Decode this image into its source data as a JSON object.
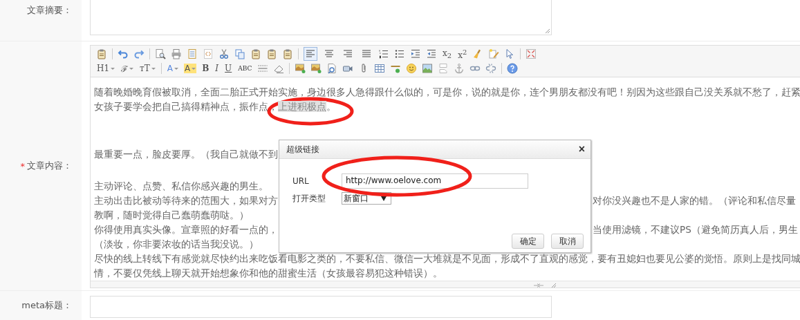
{
  "summary": {
    "label": "文章摘要："
  },
  "content_field": {
    "mark": "*",
    "label": "文章内容："
  },
  "editor": {
    "toolbar": {
      "alignment": [
        {
          "selected": true
        },
        {
          "selected": false
        },
        {
          "selected": false
        },
        {
          "selected": false
        }
      ],
      "text_buttons": [
        "x$_{2}$",
        "x$^{2}$",
        "H1",
        "ℱ",
        "ᴛT",
        "A",
        "A",
        "B",
        "I",
        "U",
        "ABC"
      ]
    },
    "lines": [
      {
        "segments": [
          {
            "text": "随着晚婚晚育假被取消，全面二胎正式开始实施，身边很多人急得跟什么似的，可是你，说的就是你，连个男朋友都没有吧！别因为这些跟自己没关系就不愁了，赶紧",
            "highlighted": false
          }
        ]
      },
      {
        "segments": [
          {
            "text": "女孩子要学会把自己搞得精神点，振作点，",
            "highlighted": false
          },
          {
            "text": "上进积极点",
            "highlighted": true
          },
          {
            "text": "。",
            "highlighted": false
          }
        ]
      },
      {
        "segments": [
          {
            "text": "最重要一点，脸皮要厚。（我自己就做不到",
            "highlighted": false
          }
        ]
      },
      {
        "segments": [
          {
            "text": "主动评论、点赞、私信你感兴趣的男生。",
            "highlighted": false
          }
        ]
      },
      {
        "segments": [
          {
            "text": "主动出击比被动等待来的范围大，如果对方",
            "highlighted": false
          }
        ],
        "after_dialog": "对你没兴趣也不是人家的错。（评论和私信尽量"
      },
      {
        "segments": [
          {
            "text": "教啊，随时觉得自己蠢萌蠢萌哒。）",
            "highlighted": false
          }
        ]
      },
      {
        "segments": [
          {
            "text": "你得使用真实头像。宣章照的好看一点的，",
            "highlighted": false
          }
        ],
        "after_dialog": "当使用滤镜，不建议PS（避免简历真人后，男生"
      },
      {
        "segments": [
          {
            "text": "（淡妆，你非要浓妆的话当我没说。）",
            "highlighted": false
          }
        ]
      },
      {
        "segments": [
          {
            "text": "尽快的线上转线下有感觉就尽快约出来吃饭看电影之类的，不要私信、微信一大堆就是不见面，形成不了直观的感觉，要有丑媳妇也要见公婆的觉悟。原则上是找同城",
            "highlighted": false
          }
        ]
      },
      {
        "segments": [
          {
            "text": "情，不要仅凭线上聊天就开始想象你和他的甜蜜生活（女孩最容易犯这种错误）。",
            "highlighted": false
          }
        ]
      }
    ]
  },
  "meta": {
    "label": "meta标题："
  },
  "dialog": {
    "title": "超级链接",
    "close": "×",
    "url_label": "URL",
    "url_value": "http://www.oelove.com",
    "target_label": "打开类型",
    "target_value": "新窗口",
    "buttons": [
      "确定",
      "取消"
    ]
  }
}
